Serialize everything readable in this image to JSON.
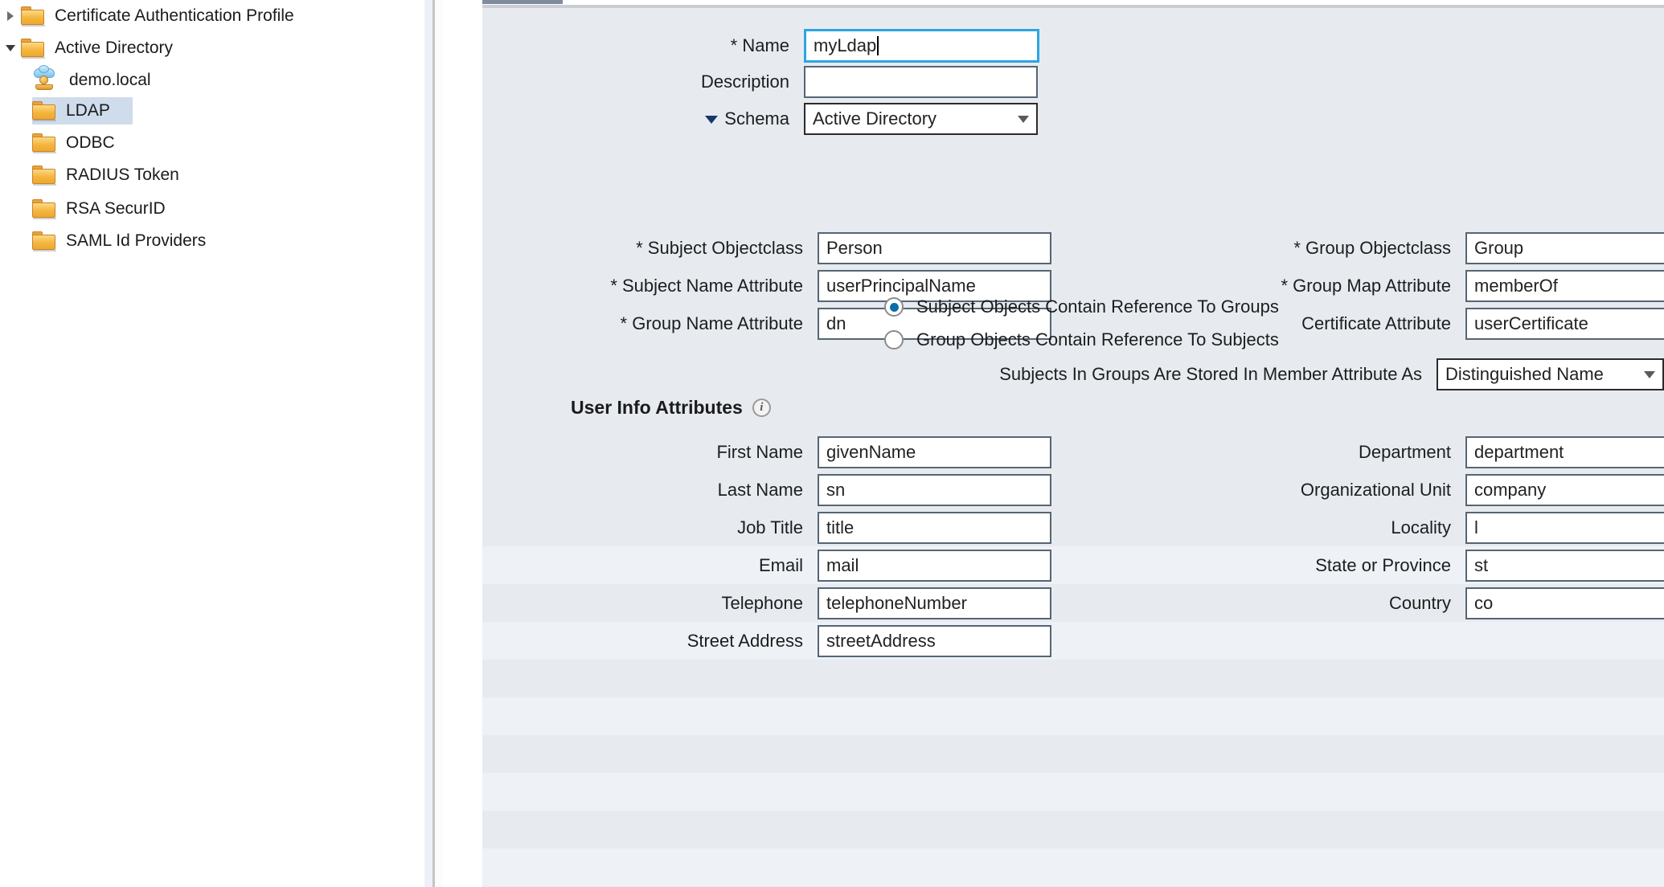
{
  "tree": {
    "items": [
      {
        "label": "Certificate Authentication Profile",
        "icon": "folder-icon",
        "twisty": "collapsed",
        "indent": 20,
        "selected": false
      },
      {
        "label": "Active Directory",
        "icon": "folder-icon",
        "twisty": "expanded",
        "indent": 20,
        "selected": false
      },
      {
        "label": "demo.local",
        "icon": "server-icon",
        "twisty": "none",
        "indent": 62,
        "selected": false
      },
      {
        "label": "LDAP",
        "icon": "folder-icon",
        "twisty": "none",
        "indent": 40,
        "selected": true
      },
      {
        "label": "ODBC",
        "icon": "folder-icon",
        "twisty": "none",
        "indent": 40,
        "selected": false
      },
      {
        "label": "RADIUS Token",
        "icon": "folder-icon",
        "twisty": "none",
        "indent": 40,
        "selected": false
      },
      {
        "label": "RSA SecurID",
        "icon": "folder-icon",
        "twisty": "none",
        "indent": 40,
        "selected": false
      },
      {
        "label": "SAML Id Providers",
        "icon": "folder-icon",
        "twisty": "none",
        "indent": 40,
        "selected": false
      }
    ]
  },
  "form": {
    "name": {
      "label": "* Name",
      "value": "myLdap",
      "focused": true
    },
    "description": {
      "label": "Description",
      "value": ""
    },
    "schema": {
      "label": "Schema",
      "value": "Active Directory"
    },
    "subject_objectclass": {
      "label": "* Subject Objectclass",
      "value": "Person"
    },
    "subject_name_attribute": {
      "label": "* Subject Name Attribute",
      "value": "userPrincipalName"
    },
    "group_name_attribute": {
      "label": "* Group Name Attribute",
      "value": "dn"
    },
    "group_objectclass": {
      "label": "* Group Objectclass",
      "value": "Group"
    },
    "group_map_attribute": {
      "label": "* Group Map Attribute",
      "value": "memberOf"
    },
    "certificate_attribute": {
      "label": "Certificate Attribute",
      "value": "userCertificate"
    },
    "radios": [
      {
        "label": "Subject Objects Contain Reference To Groups",
        "selected": true
      },
      {
        "label": "Group Objects Contain Reference To Subjects",
        "selected": false
      }
    ],
    "member_attribute": {
      "label": "Subjects In Groups Are Stored In Member Attribute As",
      "value": "Distinguished Name"
    },
    "user_info": {
      "heading": "User Info Attributes",
      "info_glyph": "i",
      "left": [
        {
          "label": "First Name",
          "value": "givenName"
        },
        {
          "label": "Last Name",
          "value": "sn"
        },
        {
          "label": "Job Title",
          "value": "title"
        },
        {
          "label": "Email",
          "value": "mail"
        },
        {
          "label": "Telephone",
          "value": "telephoneNumber"
        },
        {
          "label": "Street Address",
          "value": "streetAddress"
        }
      ],
      "right": [
        {
          "label": "Department",
          "value": "department"
        },
        {
          "label": "Organizational Unit",
          "value": "company"
        },
        {
          "label": "Locality",
          "value": "l"
        },
        {
          "label": "State or Province",
          "value": "st"
        },
        {
          "label": "Country",
          "value": "co"
        }
      ]
    }
  },
  "colors": {
    "panel_bg": "#e7ebf0",
    "stripe_bg": "#eef2f7",
    "focus_border": "#2ba6e0",
    "input_border": "#566573",
    "tree_selection": "#cfdceb",
    "folder_gold": "#f4b53f",
    "radio_dot": "#0a6fa8"
  }
}
